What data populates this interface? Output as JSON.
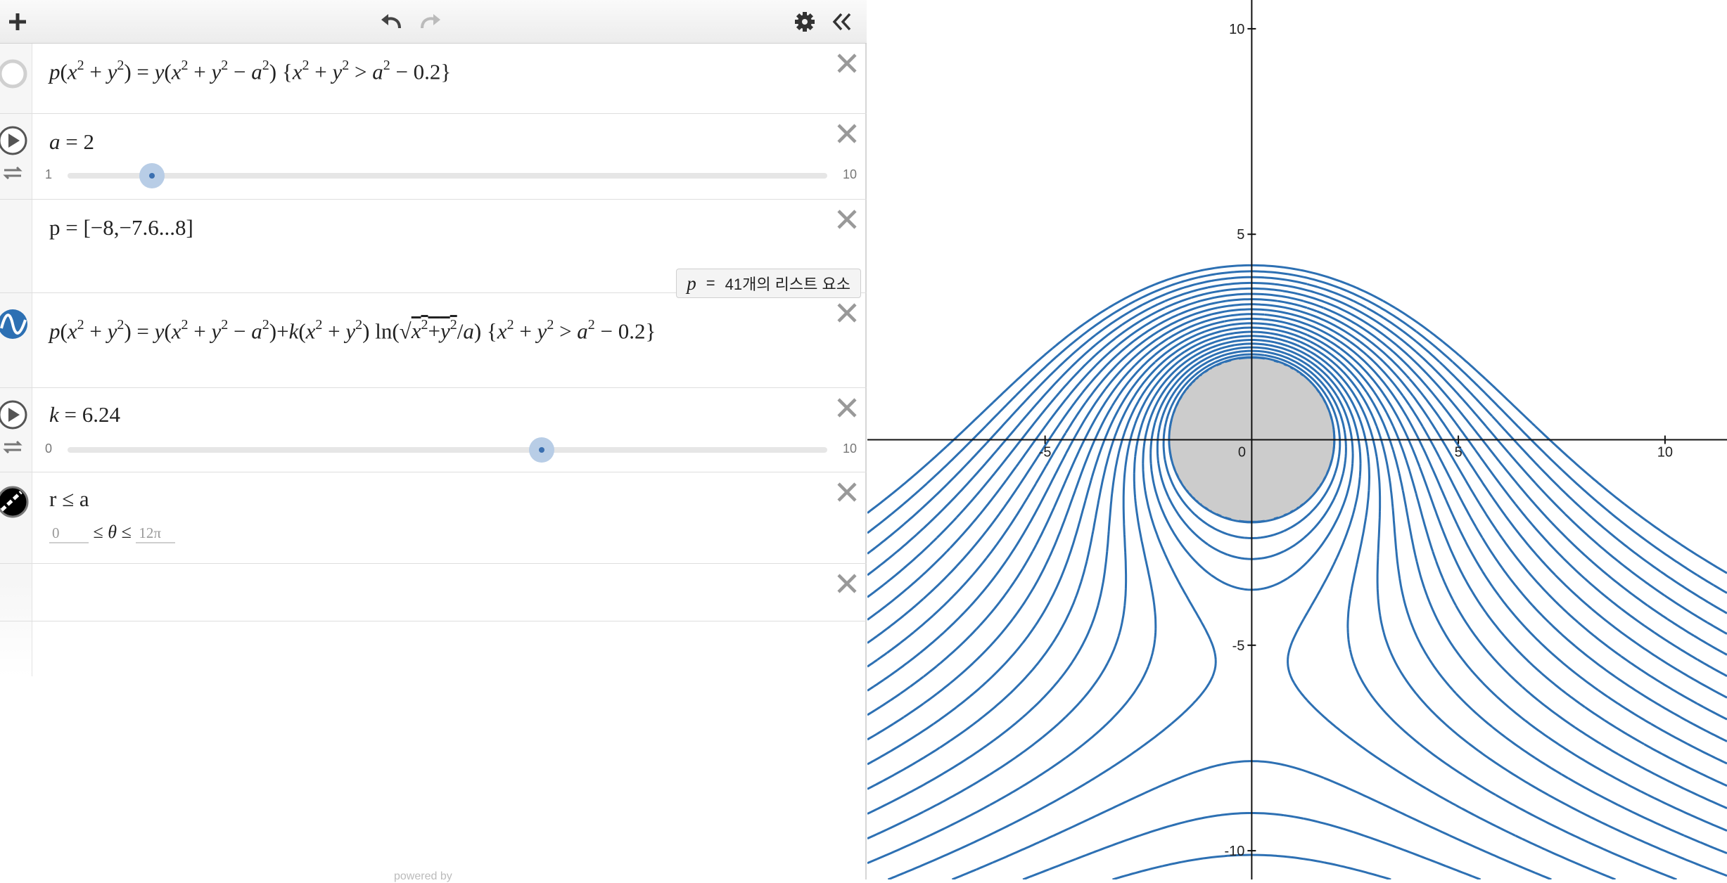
{
  "toolbar": {
    "add_icon": "plus-icon",
    "undo_icon": "undo-icon",
    "redo_icon": "redo-icon",
    "settings_icon": "gear-icon",
    "collapse_icon": "double-chevron-left-icon"
  },
  "expressions": [
    {
      "id": "expr1",
      "text": "p(x²+y²) = y(x²+y²−a²){x²+y² > a²−0.2}",
      "color": "#cccccc"
    },
    {
      "id": "slider-a",
      "name": "a",
      "value": "2",
      "min": "1",
      "max": "10",
      "fraction": 0.111
    },
    {
      "id": "list-p",
      "text": "p = [−8,−7.6...8]",
      "badge_var": "p",
      "badge_eq": "=",
      "badge_text": "41개의 리스트 요소"
    },
    {
      "id": "expr4",
      "text": "p(x²+y²) = y(x²+y²−a²)+k(x²+y²) ln(√(x²+y²)/a){x²+y² > a²−0.2}",
      "color": "#2d70b3"
    },
    {
      "id": "slider-k",
      "name": "k",
      "value": "6.24",
      "min": "0",
      "max": "10",
      "fraction": 0.624
    },
    {
      "id": "polar",
      "text": "r ≤ a",
      "theta_min": "0",
      "theta_max": "12π",
      "color": "#000000"
    },
    {
      "id": "empty",
      "text": ""
    }
  ],
  "graph": {
    "x_ticks": [
      "-5",
      "0",
      "5",
      "10"
    ],
    "y_ticks": [
      "10",
      "5",
      "-5",
      "-10"
    ],
    "xlim": [
      -9.3,
      11.5
    ],
    "ylim": [
      -10.7,
      10.7
    ],
    "curve_color": "#2d70b3",
    "disk_color": "#cccccc",
    "a": 2,
    "k": 6.24,
    "p_start": -8,
    "p_step": 0.4,
    "p_count": 41
  },
  "footer": {
    "powered": "powered by"
  }
}
